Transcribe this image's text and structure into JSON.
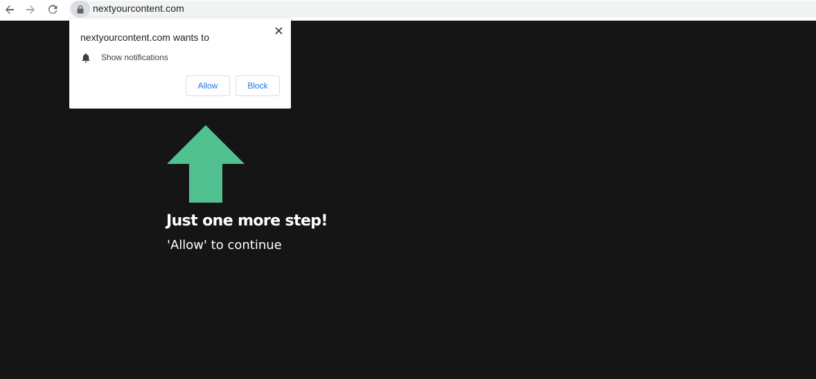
{
  "browser": {
    "url": "nextyourcontent.com",
    "icons": {
      "back": "back-arrow-icon",
      "forward": "forward-arrow-icon",
      "reload": "reload-icon",
      "lock": "lock-icon"
    }
  },
  "permission_popup": {
    "title": "nextyourcontent.com wants to",
    "permission_label": "Show notifications",
    "allow_label": "Allow",
    "block_label": "Block",
    "icons": {
      "close": "close-icon",
      "bell": "bell-icon"
    },
    "button_text_color": "#1a73e8"
  },
  "page": {
    "headline": "Just one more step!",
    "subline": "'Allow' to continue",
    "background_color": "#151515",
    "arrow_color": "#52c191"
  }
}
